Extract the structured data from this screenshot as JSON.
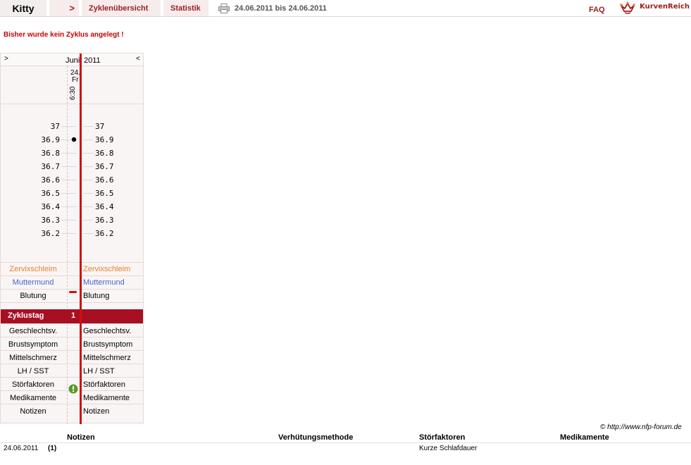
{
  "header": {
    "user_name": "Kitty",
    "nav_arrow": ">",
    "tabs": [
      {
        "label": "Zyklenübersicht"
      },
      {
        "label": "Statistik"
      }
    ],
    "date_range": "24.06.2011 bis 24.06.2011",
    "faq_label": "FAQ",
    "logo_text": "KurvenReich"
  },
  "message": "Bisher wurde kein Zyklus angelegt !",
  "chart": {
    "nav_prev": ">",
    "nav_next": "<",
    "month": "Juni",
    "year": "2011",
    "day": {
      "number": "24.",
      "weekday": "Fr",
      "time": "6:30"
    },
    "temperature_scale": [
      "37",
      "36.9",
      "36.8",
      "36.7",
      "36.6",
      "36.5",
      "36.4",
      "36.3",
      "36.2"
    ],
    "measured_temperature": 36.9,
    "rows_top": [
      {
        "label": "Zervixschleim",
        "color": "#e8802a"
      },
      {
        "label": "Muttermund",
        "color": "#4466cc"
      },
      {
        "label": "Blutung",
        "color": "#000000"
      }
    ],
    "zyklustag_label": "Zyklustag",
    "zyklustag_value": "1",
    "rows_bottom": [
      {
        "label": "Geschlechtsv."
      },
      {
        "label": "Brustsymptom"
      },
      {
        "label": "Mittelschmerz"
      },
      {
        "label": "LH / SST"
      },
      {
        "label": "Störfaktoren"
      },
      {
        "label": "Medikamente"
      },
      {
        "label": "Notizen"
      }
    ],
    "accent_color": "#cc1111",
    "bar_color": "#a80f23"
  },
  "copyright": "© http://www.nfp-forum.de",
  "table": {
    "headers": [
      "Notizen",
      "Verhütungsmethode",
      "Störfaktoren",
      "Medikamente"
    ],
    "rows": [
      {
        "date": "24.06.2011",
        "notes": "(1)",
        "method": "",
        "disturbances": "Kurze Schlafdauer",
        "medication": ""
      }
    ]
  }
}
